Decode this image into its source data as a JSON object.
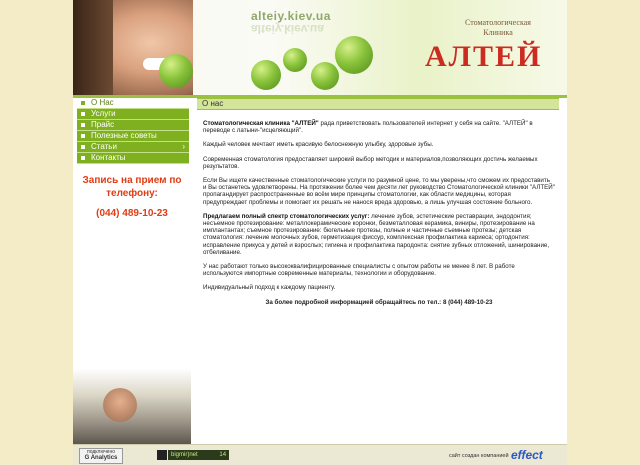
{
  "header": {
    "site_url": "alteiy.kiev.ua",
    "clinic_subtitle": "Стоматологическая Клиника",
    "brand": "АЛТЕЙ"
  },
  "sidebar": {
    "items": [
      {
        "label": "О Нас"
      },
      {
        "label": "Услуги"
      },
      {
        "label": "Прайс"
      },
      {
        "label": "Полезные советы"
      },
      {
        "label": "Статьи"
      },
      {
        "label": "Контакты"
      }
    ],
    "appointment_title": "Запись на прием по телефону:",
    "phone": "(044) 489-10-23"
  },
  "main": {
    "title": "О нас",
    "p1_bold": "Стоматологическая клиника \"АЛТЕЙ\"",
    "p1_rest": " рада приветствовать пользователей интернет у себя на сайте. \"АЛТЕЙ\" в переводе с латыни-\"исцеляющий\".",
    "p2": "Каждый человек мечтает иметь красивую белоснежную улыбку, здоровые зубы.",
    "p3": "Современная стоматология предоставляет широкий выбор методик и материалов,позволяющих достичь желаемых результатов.",
    "p4": "Если Вы ищете качественные стоматологические услуги по разумной цене, то мы уверены,что сможем их предоставить и Вы останетесь удовлетворены. На протяжении более чем десяти лет руководство Стоматологической клиники \"АЛТЕЙ\" пропагандирует распространенные во всём мире принципы стоматологии, как области медицины, которая предупреждает проблемы и помогает их решать не нанося вреда здоровью, а лишь улучшая состояние больного.",
    "p5_bold": "Предлагаем полный спектр стоматологических услуг:",
    "p5_rest": " лечение зубов, эстетические реставрации, эндодонтия; несъемное протезирование: металлокерамические коронки, безметалловая керамика, виниры, протезирование на имплантантах; съемное протезирование: бюгельные протезы, полные и частичные съемные протезы; детская стоматология: лечение молочных зубов, герметизация фиссур, комплексная профилактика кариеса; ортодонтия: исправление прикуса у детей и взрослых; гигиена и профилактика пародонта: снятие зубных отложений, шинирование, отбеливание.",
    "p6": "У нас работают только высококвалифицированные специалисты с опытом работы не менее 8 лет. В работе используются импортные современные материалы, технологии и оборудование.",
    "p7": "Индивидуальный подход к каждому пациенту.",
    "cta": "За более подробной информацией обращайтесь по тел.: 8 (044) 489-10-23"
  },
  "footer": {
    "ga_line1": "подключено",
    "ga_line2": "G Analytics",
    "counter_label": "bigmir)net",
    "counter_value": "14",
    "credit": "сайт создан компанией",
    "effect_logo": "effect"
  }
}
